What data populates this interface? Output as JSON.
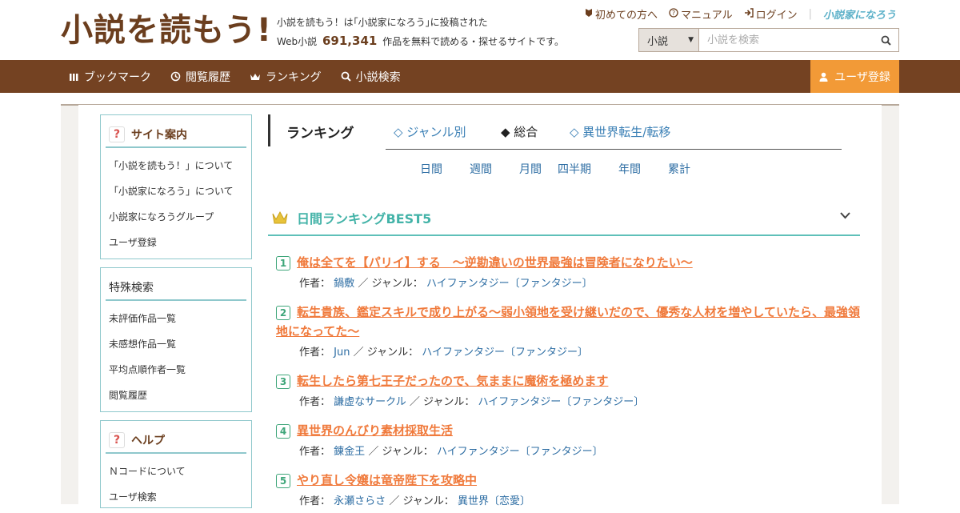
{
  "header": {
    "logo": "小説を読もう!",
    "intro_line1": "小説を読もう！は｢小説家になろう｣に投稿された",
    "intro_prefix": "Web小説",
    "count": "691,341",
    "intro_suffix": "作品を無料で読める・探せるサイトです。",
    "links": [
      {
        "icon": "beginner-icon",
        "label": "初めての方へ"
      },
      {
        "icon": "question-icon",
        "label": "マニュアル"
      },
      {
        "icon": "login-icon",
        "label": "ログイン"
      }
    ],
    "narou_logo": "小説家になろう"
  },
  "search": {
    "category": "小説",
    "placeholder": "小説を検索"
  },
  "nav": {
    "items": [
      {
        "icon": "bookmark-icon",
        "label": "ブックマーク"
      },
      {
        "icon": "history-icon",
        "label": "閲覧履歴"
      },
      {
        "icon": "crown-icon",
        "label": "ランキング"
      },
      {
        "icon": "search-icon",
        "label": "小説検索"
      }
    ],
    "register": "ユーザ登録"
  },
  "sidebar": {
    "guide": {
      "title": "サイト案内",
      "items": [
        "「小説を読もう！」について",
        "「小説家になろう」について",
        "小説家になろうグループ",
        "ユーザ登録"
      ]
    },
    "special": {
      "title": "特殊検索",
      "items": [
        "未評価作品一覧",
        "未感想作品一覧",
        "平均点順作者一覧",
        "閲覧履歴"
      ]
    },
    "help": {
      "title": "ヘルプ",
      "items": [
        "Ｎコードについて",
        "ユーザ検索"
      ]
    }
  },
  "ranking": {
    "heading": "ランキング",
    "tabs": [
      "◇ ジャンル別",
      "◆ 総合",
      "◇ 異世界転生/転移"
    ],
    "periods": [
      "日間",
      "週間",
      "月間",
      "四半期",
      "年間",
      "累計"
    ],
    "best_title": "日間ランキングBEST5",
    "author_label": "作者：",
    "genre_label": "／ ジャンル：",
    "entries": [
      {
        "rank": "1",
        "title": "俺は全てを【パリイ】する　〜逆勘違いの世界最強は冒険者になりたい〜",
        "author": "鍋敷",
        "genre": "ハイファンタジー〔ファンタジー〕"
      },
      {
        "rank": "2",
        "title": "転生貴族、鑑定スキルで成り上がる～弱小領地を受け継いだので、優秀な人材を増やしていたら、最強領地になってた～",
        "author": "Jun",
        "genre": "ハイファンタジー〔ファンタジー〕"
      },
      {
        "rank": "3",
        "title": "転生したら第七王子だったので、気ままに魔術を極めます",
        "author": "謙虚なサークル",
        "genre": "ハイファンタジー〔ファンタジー〕"
      },
      {
        "rank": "4",
        "title": "異世界のんびり素材採取生活",
        "author": "錬金王",
        "genre": "ハイファンタジー〔ファンタジー〕"
      },
      {
        "rank": "5",
        "title": "やり直し令嬢は竜帝陛下を攻略中",
        "author": "永瀬さらさ",
        "genre": "異世界〔恋愛〕"
      }
    ]
  },
  "colors": {
    "brand_brown": "#744222",
    "register_orange": "#f29a37",
    "title_orange": "#f07a3c",
    "teal": "#43b3a8"
  }
}
